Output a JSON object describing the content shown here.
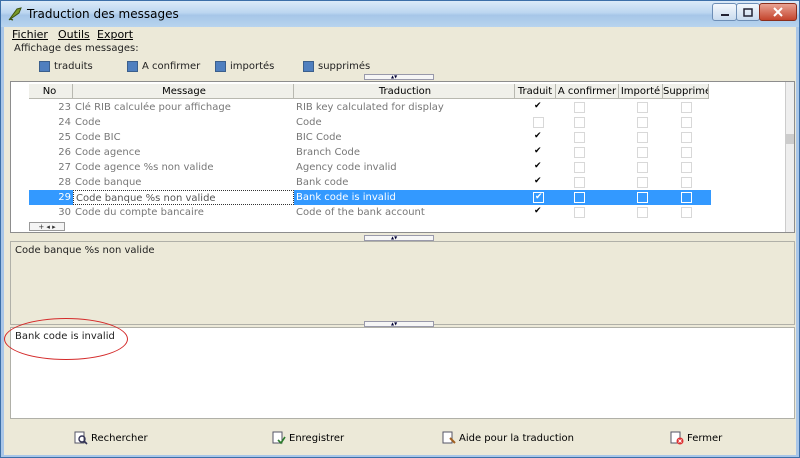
{
  "window": {
    "title": "Traduction des messages"
  },
  "menu": {
    "items": [
      "Fichier",
      "Outils",
      "Export"
    ]
  },
  "filter": {
    "label": "Affichage des messages:",
    "options": [
      "traduits",
      "A confirmer",
      "importés",
      "supprimés"
    ]
  },
  "grid": {
    "headers": [
      "No",
      "Message",
      "Traduction",
      "Traduit",
      "A confirmer",
      "Importé",
      "Supprimé"
    ],
    "rows": [
      {
        "no": "23",
        "message": "Clé RIB calculée pour affichage",
        "translation": "RIB key calculated for display",
        "translated": true
      },
      {
        "no": "24",
        "message": "Code",
        "translation": "Code",
        "translated": false
      },
      {
        "no": "25",
        "message": "Code BIC",
        "translation": "BIC Code",
        "translated": true
      },
      {
        "no": "26",
        "message": "Code agence",
        "translation": "Branch Code",
        "translated": true
      },
      {
        "no": "27",
        "message": "Code agence %s non valide",
        "translation": "Agency code invalid",
        "translated": true
      },
      {
        "no": "28",
        "message": "Code banque",
        "translation": "Bank code",
        "translated": true
      },
      {
        "no": "29",
        "message": "Code banque %s non valide",
        "translation": "Bank code is invalid",
        "translated": true,
        "selected": true
      },
      {
        "no": "30",
        "message": "Code du compte bancaire",
        "translation": "Code of the bank account",
        "translated": true
      }
    ]
  },
  "source_text": "Code banque %s non valide",
  "translation_text": "Bank code is invalid",
  "buttons": {
    "search": "Rechercher",
    "save": "Enregistrer",
    "help": "Aide pour la traduction",
    "close": "Fermer"
  },
  "colors": {
    "selection": "#3399ff",
    "highlight_oval": "#d42a2a"
  }
}
